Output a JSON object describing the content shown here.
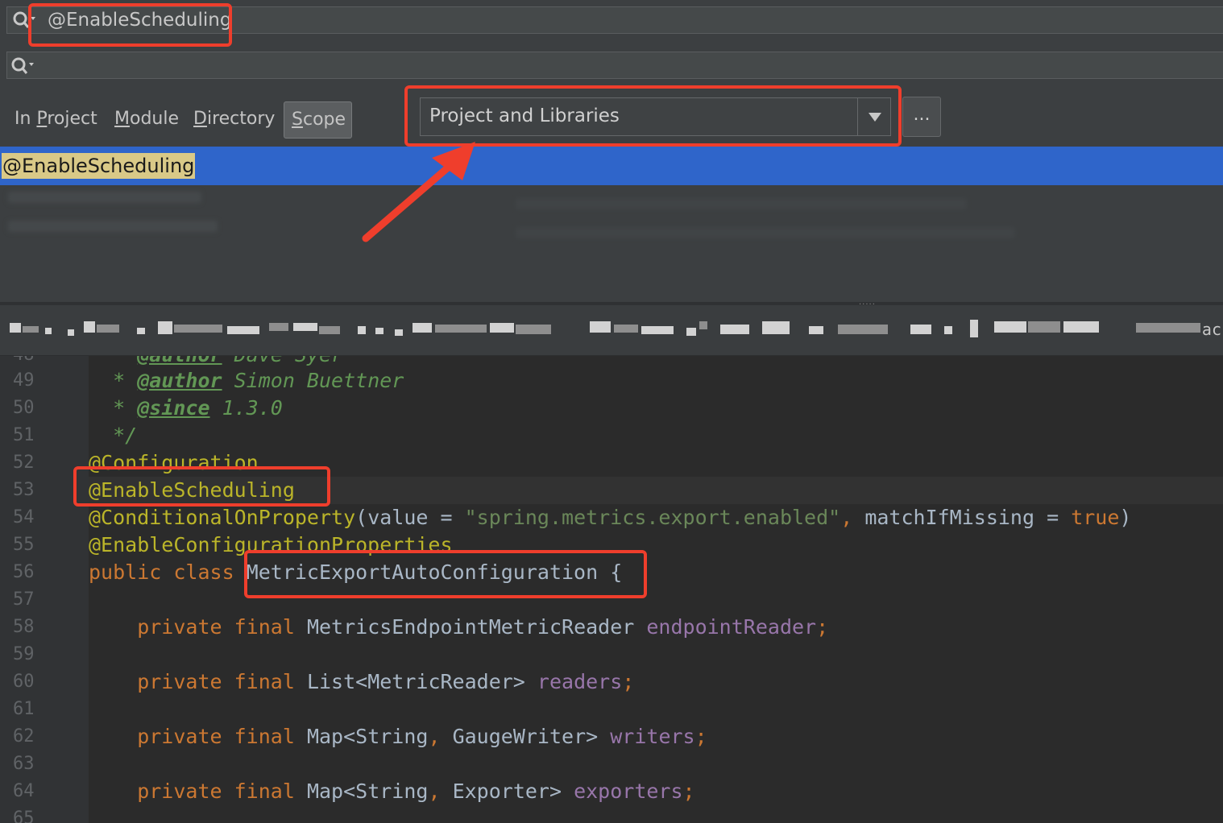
{
  "search": {
    "text_query": "@EnableScheduling",
    "file_mask_query": ""
  },
  "scope_tabs": [
    {
      "label_prefix": "In ",
      "label_mnemonic": "P",
      "label_rest": "roject"
    },
    {
      "label_prefix": "",
      "label_mnemonic": "M",
      "label_rest": "odule"
    },
    {
      "label_prefix": "",
      "label_mnemonic": "D",
      "label_rest": "irectory"
    },
    {
      "label_prefix": "",
      "label_mnemonic": "S",
      "label_rest": "cope",
      "active": true
    }
  ],
  "scope_dropdown": {
    "selected": "Project and Libraries"
  },
  "more_button": {
    "label": "..."
  },
  "results": {
    "selected_match": "@EnableScheduling"
  },
  "path_bar": {
    "tail_fragment": "ac"
  },
  "editor": {
    "lines": [
      {
        "no": "49",
        "parts": [
          {
            "c": "cm",
            "t": "  * "
          },
          {
            "c": "cm-tag",
            "t": "@author"
          },
          {
            "c": "cm",
            "t": " Simon Buettner"
          }
        ]
      },
      {
        "no": "50",
        "parts": [
          {
            "c": "cm",
            "t": "  * "
          },
          {
            "c": "cm-tag",
            "t": "@since"
          },
          {
            "c": "cm",
            "t": " 1.3.0"
          }
        ]
      },
      {
        "no": "51",
        "parts": [
          {
            "c": "cm",
            "t": "  */"
          }
        ]
      },
      {
        "no": "52",
        "parts": [
          {
            "c": "an",
            "t": "@Configuration"
          }
        ]
      },
      {
        "no": "53",
        "parts": [
          {
            "c": "an",
            "t": "@EnableScheduling"
          }
        ],
        "caret": true
      },
      {
        "no": "54",
        "parts": [
          {
            "c": "an",
            "t": "@ConditionalOnProperty"
          },
          {
            "c": "pn",
            "t": "(value = "
          },
          {
            "c": "str",
            "t": "\"spring.metrics.export.enabled\""
          },
          {
            "c": "kw",
            "t": ", "
          },
          {
            "c": "pn",
            "t": "matchIfMissing = "
          },
          {
            "c": "kw",
            "t": "true"
          },
          {
            "c": "pn",
            "t": ")"
          }
        ]
      },
      {
        "no": "55",
        "parts": [
          {
            "c": "an",
            "t": "@EnableConfigurationProperties"
          }
        ]
      },
      {
        "no": "56",
        "parts": [
          {
            "c": "kw",
            "t": "public class "
          },
          {
            "c": "cls",
            "t": "MetricExportAutoConfiguration "
          },
          {
            "c": "pn",
            "t": "{"
          }
        ]
      },
      {
        "no": "57",
        "parts": []
      },
      {
        "no": "58",
        "parts": [
          {
            "c": "kw",
            "t": "    private final "
          },
          {
            "c": "cls",
            "t": "MetricsEndpointMetricReader "
          },
          {
            "c": "fld",
            "t": "endpointReader"
          },
          {
            "c": "kw",
            "t": ";"
          }
        ]
      },
      {
        "no": "59",
        "parts": []
      },
      {
        "no": "60",
        "parts": [
          {
            "c": "kw",
            "t": "    private final "
          },
          {
            "c": "cls",
            "t": "List<MetricReader> "
          },
          {
            "c": "fld",
            "t": "readers"
          },
          {
            "c": "kw",
            "t": ";"
          }
        ]
      },
      {
        "no": "61",
        "parts": []
      },
      {
        "no": "62",
        "parts": [
          {
            "c": "kw",
            "t": "    private final "
          },
          {
            "c": "cls",
            "t": "Map<String"
          },
          {
            "c": "kw",
            "t": ", "
          },
          {
            "c": "cls",
            "t": "GaugeWriter> "
          },
          {
            "c": "fld",
            "t": "writers"
          },
          {
            "c": "kw",
            "t": ";"
          }
        ]
      },
      {
        "no": "63",
        "parts": []
      },
      {
        "no": "64",
        "parts": [
          {
            "c": "kw",
            "t": "    private final "
          },
          {
            "c": "cls",
            "t": "Map<String"
          },
          {
            "c": "kw",
            "t": ", "
          },
          {
            "c": "cls",
            "t": "Exporter> "
          },
          {
            "c": "fld",
            "t": "exporters"
          },
          {
            "c": "kw",
            "t": ";"
          }
        ]
      },
      {
        "no": "65",
        "parts": []
      }
    ]
  },
  "colors": {
    "annotation_box": "#ef3e2c",
    "selection": "#2f65ca",
    "match_highlight": "#d9c987"
  }
}
